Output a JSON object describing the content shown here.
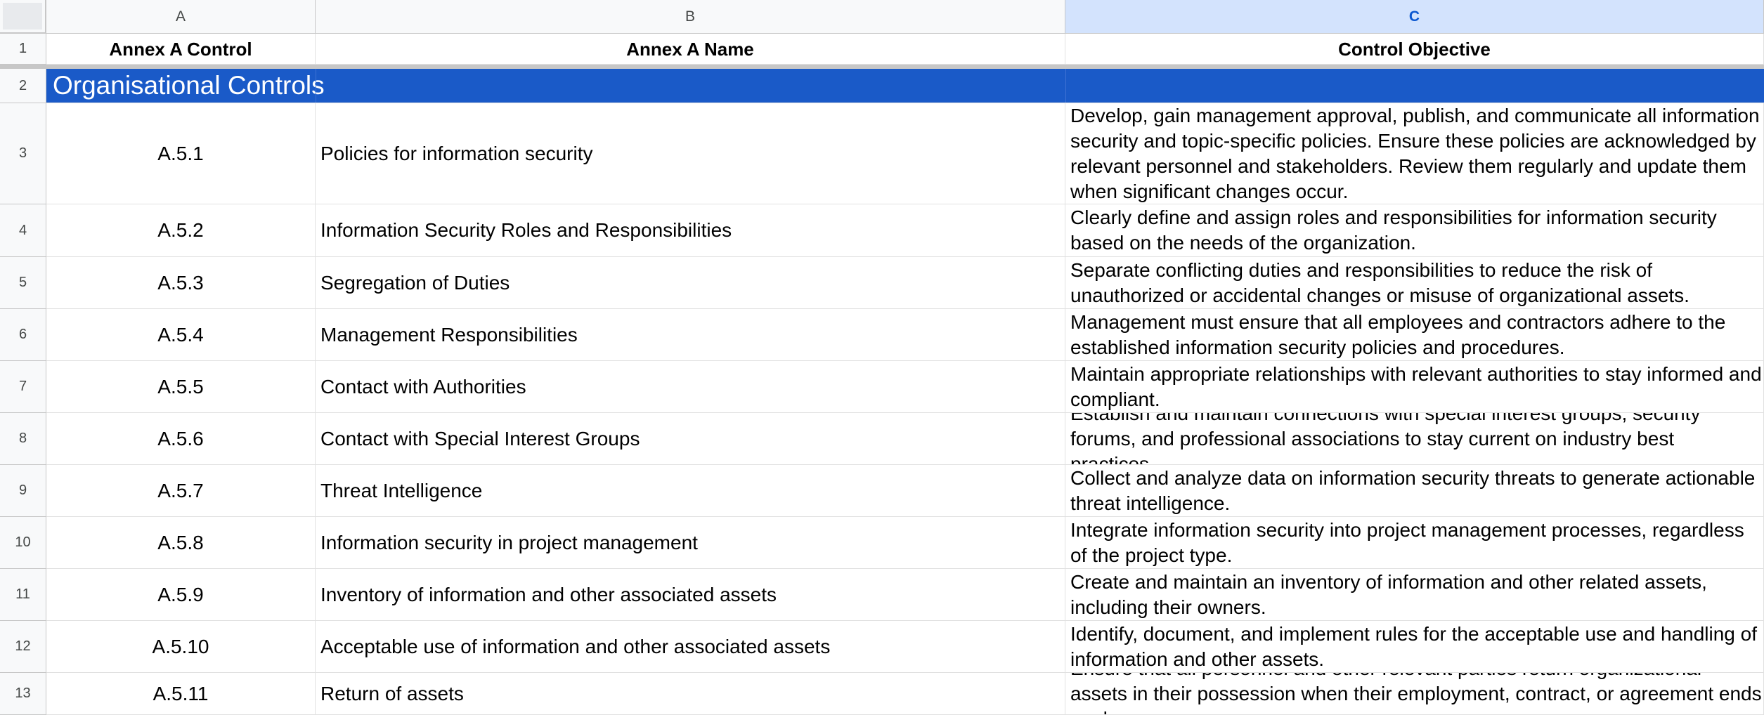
{
  "sheet": {
    "columns": [
      {
        "letter": "A",
        "selected": false
      },
      {
        "letter": "B",
        "selected": false
      },
      {
        "letter": "C",
        "selected": true
      }
    ],
    "header_row": {
      "row_number": "1",
      "cells": [
        "Annex A Control",
        "Annex A Name",
        "Control Objective"
      ]
    },
    "section_row": {
      "row_number": "2",
      "label": "Organisational Controls",
      "fill_color": "#1a5ac8"
    },
    "rows": [
      {
        "row_number": "3",
        "control": "A.5.1",
        "name": "Policies for information security",
        "objective": "Develop, gain management approval, publish, and communicate all information security and topic-specific policies. Ensure these policies are acknowledged by relevant personnel and stakeholders. Review them regularly and update them when significant changes occur."
      },
      {
        "row_number": "4",
        "control": "A.5.2",
        "name": "Information Security Roles and Responsibilities",
        "objective": "Clearly define and assign roles and responsibilities for information security based on the needs of the organization."
      },
      {
        "row_number": "5",
        "control": "A.5.3",
        "name": "Segregation of Duties",
        "objective": "Separate conflicting duties and responsibilities to reduce the risk of unauthorized or accidental changes or misuse of organizational assets."
      },
      {
        "row_number": "6",
        "control": "A.5.4",
        "name": "Management Responsibilities",
        "objective": "Management must ensure that all employees and contractors adhere to the established information security policies and procedures."
      },
      {
        "row_number": "7",
        "control": "A.5.5",
        "name": "Contact with Authorities",
        "objective": "Maintain appropriate relationships with relevant authorities to stay informed and compliant."
      },
      {
        "row_number": "8",
        "control": "A.5.6",
        "name": "Contact with Special Interest Groups",
        "objective": "Establish and maintain connections with special interest groups, security forums, and professional associations to stay current on industry best practices."
      },
      {
        "row_number": "9",
        "control": "A.5.7",
        "name": "Threat Intelligence",
        "objective": "Collect and analyze data on information security threats to generate actionable threat intelligence."
      },
      {
        "row_number": "10",
        "control": "A.5.8",
        "name": "Information security in project management",
        "objective": "Integrate information security into project management processes, regardless of the project type."
      },
      {
        "row_number": "11",
        "control": "A.5.9",
        "name": "Inventory of information and other associated assets",
        "objective": "Create and maintain an inventory of information and other related assets, including their owners."
      },
      {
        "row_number": "12",
        "control": "A.5.10",
        "name": "Acceptable use of information and other associated assets",
        "objective": "Identify, document, and implement rules for the acceptable use and handling of information and other assets."
      },
      {
        "row_number": "13",
        "control": "A.5.11",
        "name": "Return of assets",
        "objective": "Ensure that all personnel and other relevant parties return organizational assets in their possession when their employment, contract, or agreement ends or changes."
      }
    ]
  }
}
